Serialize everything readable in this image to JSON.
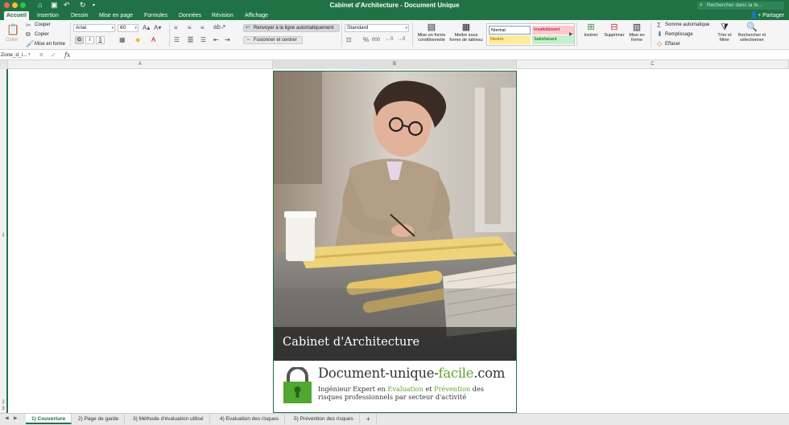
{
  "window": {
    "title": "Cabinet d'Architecture - Document Unique",
    "search_placeholder": "Rechercher dans la fe..."
  },
  "ribbon_tabs": [
    "Accueil",
    "Insertion",
    "Dessin",
    "Mise en page",
    "Formules",
    "Données",
    "Révision",
    "Affichage"
  ],
  "active_tab": "Accueil",
  "share_label": "Partager",
  "clipboard": {
    "paste": "Coller",
    "cut": "Couper",
    "copy": "Copier",
    "format": "Mise en forme"
  },
  "font": {
    "name": "Arial",
    "size": "60",
    "bold": "G",
    "italic": "I",
    "underline": "S"
  },
  "alignment": {
    "wrap": "Renvoyer à la ligne automatiquement",
    "merge": "Fusionner et centrer"
  },
  "number": {
    "format": "Standard",
    "percent": "%",
    "thousands": "000"
  },
  "styles": {
    "conditional": "Mise en forme conditionnelle",
    "as_table": "Mettre sous forme de tableau",
    "normal": "Normal",
    "bad": "Insatisfaisant",
    "neutral": "Neutre",
    "good": "Satisfaisant"
  },
  "cells": {
    "insert": "Insérer",
    "delete": "Supprimer",
    "format": "Mise en forme"
  },
  "editing": {
    "autosum": "Somme automatique",
    "fill": "Remplissage",
    "clear": "Effacer",
    "sort": "Trier et filtrer",
    "find": "Rechercher et sélectionner"
  },
  "formula_bar": {
    "name_box": "Zone_d_i...",
    "fx": "fx",
    "formula": ""
  },
  "columns": [
    "A",
    "B",
    "C"
  ],
  "rows": [
    "1",
    "2",
    "3"
  ],
  "cover": {
    "caption": "Cabinet d'Architecture",
    "brand_prefix": "Document-unique-",
    "brand_green": "facile",
    "brand_suffix": ".com",
    "tagline_1": "Ingénieur Expert en ",
    "tagline_eval": "Evaluation",
    "tagline_et": " et ",
    "tagline_prev": "Prévention",
    "tagline_2": " des",
    "tagline_3": "risques professionnels par secteur d'activité"
  },
  "sheet_tabs": [
    "1) Couverture",
    "2) Page de garde",
    "3) Méthode d'évaluation utilisé",
    "4) Evaluation des risques",
    "5) Prévention des risques"
  ],
  "active_sheet": "1) Couverture",
  "colors": {
    "excel_green": "#207245",
    "brand_green": "#5ea62b"
  }
}
